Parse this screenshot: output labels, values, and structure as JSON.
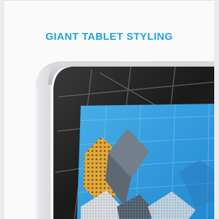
{
  "card": {
    "title": "GIANT TABLET STYLING"
  },
  "image": {
    "subject": "giant tablet with brushed metal frame",
    "colors": {
      "accent": "#1fa3dc",
      "frame": "#c9cbce",
      "bezel": "#111111",
      "screen_blue": "#2f9be0"
    }
  }
}
